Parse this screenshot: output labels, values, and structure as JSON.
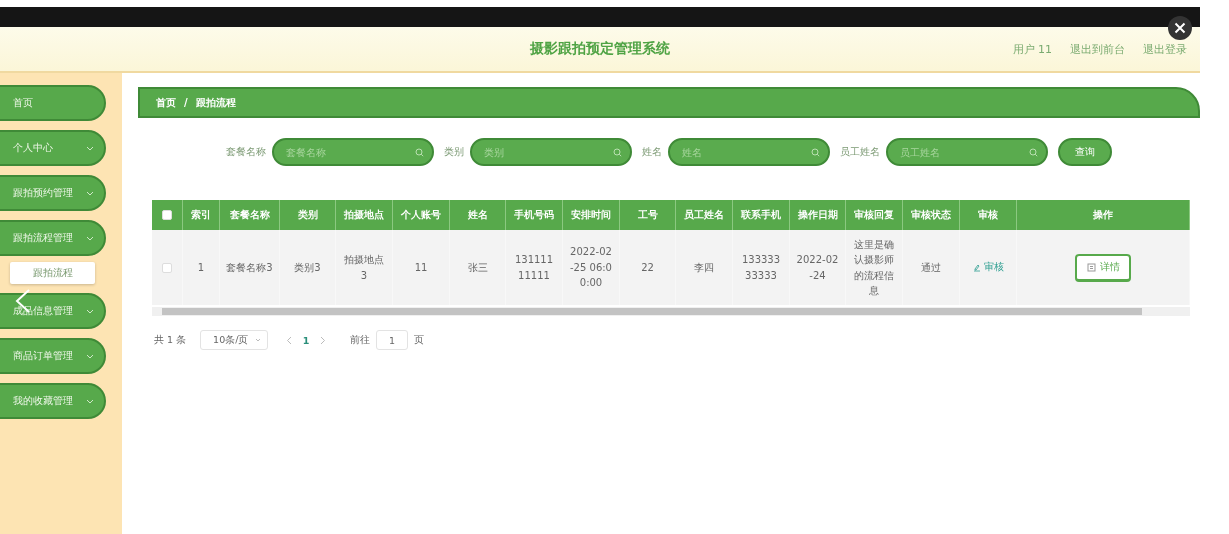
{
  "header": {
    "title": "摄影跟拍预定管理系统",
    "links": [
      "用户 11",
      "退出到前台",
      "退出登录"
    ]
  },
  "sidebar": {
    "items": [
      {
        "label": "首页",
        "kind": "link"
      },
      {
        "label": "个人中心",
        "kind": "menu"
      },
      {
        "label": "跟拍预约管理",
        "kind": "menu"
      },
      {
        "label": "跟拍流程管理",
        "kind": "menu",
        "children": [
          {
            "label": "跟拍流程"
          }
        ]
      },
      {
        "label": "成品信息管理",
        "kind": "menu"
      },
      {
        "label": "商品订单管理",
        "kind": "menu"
      },
      {
        "label": "我的收藏管理",
        "kind": "menu"
      }
    ]
  },
  "breadcrumb": {
    "items": [
      "首页",
      "跟拍流程"
    ],
    "separator": "/"
  },
  "search": {
    "fields": [
      {
        "label": "套餐名称",
        "placeholder": "套餐名称"
      },
      {
        "label": "类别",
        "placeholder": "类别"
      },
      {
        "label": "姓名",
        "placeholder": "姓名"
      },
      {
        "label": "员工姓名",
        "placeholder": "员工姓名"
      }
    ],
    "button": "查询"
  },
  "table": {
    "select_all_checked": false,
    "columns": [
      "索引",
      "套餐名称",
      "类别",
      "拍摄地点",
      "个人账号",
      "姓名",
      "手机号码",
      "安排时间",
      "工号",
      "员工姓名",
      "联系手机",
      "操作日期",
      "审核回复",
      "审核状态",
      "审核",
      "操作"
    ],
    "rows": [
      {
        "checked": false,
        "cells": [
          "1",
          "套餐名称3",
          "类别3",
          "拍摄地点3",
          "11",
          "张三",
          "13111111111",
          "2022-02-25 06:00:00",
          "22",
          "李四",
          "13333333333",
          "2022-02-24",
          "这里是确认摄影师的流程信息",
          "通过"
        ],
        "review": "审核",
        "action": "详情"
      }
    ]
  },
  "pagination": {
    "total": "共 1 条",
    "page_size": "10条/页",
    "pages": [
      {
        "label": "1",
        "selected": true
      }
    ],
    "goto_label": "前往",
    "goto_value": "1",
    "goto_suffix": "页"
  }
}
